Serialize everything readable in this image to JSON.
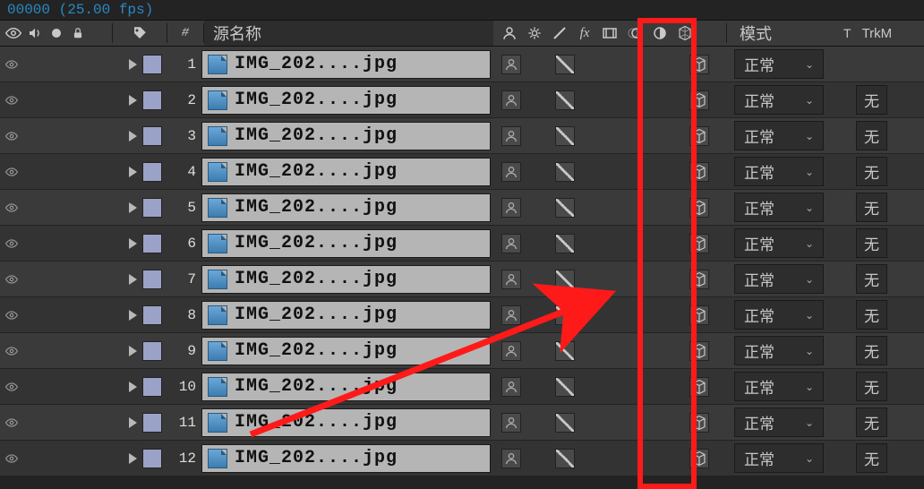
{
  "frame_info": "00000 (25.00 fps)",
  "header": {
    "source_label": "源名称",
    "mode_label": "模式",
    "t_label": "T",
    "trkmat_label": "TrkM"
  },
  "mode_value": "正常",
  "trkmat_value": "无",
  "layers": [
    {
      "index": 1,
      "name": "IMG_202....jpg",
      "show_trkmat": false
    },
    {
      "index": 2,
      "name": "IMG_202....jpg",
      "show_trkmat": true
    },
    {
      "index": 3,
      "name": "IMG_202....jpg",
      "show_trkmat": true
    },
    {
      "index": 4,
      "name": "IMG_202....jpg",
      "show_trkmat": true
    },
    {
      "index": 5,
      "name": "IMG_202....jpg",
      "show_trkmat": true
    },
    {
      "index": 6,
      "name": "IMG_202....jpg",
      "show_trkmat": true
    },
    {
      "index": 7,
      "name": "IMG_202....jpg",
      "show_trkmat": true
    },
    {
      "index": 8,
      "name": "IMG_202....jpg",
      "show_trkmat": true
    },
    {
      "index": 9,
      "name": "IMG_202....jpg",
      "show_trkmat": true
    },
    {
      "index": 10,
      "name": "IMG_202....jpg",
      "show_trkmat": true
    },
    {
      "index": 11,
      "name": "IMG_202....jpg",
      "show_trkmat": true
    },
    {
      "index": 12,
      "name": "IMG_202....jpg",
      "show_trkmat": true
    }
  ]
}
